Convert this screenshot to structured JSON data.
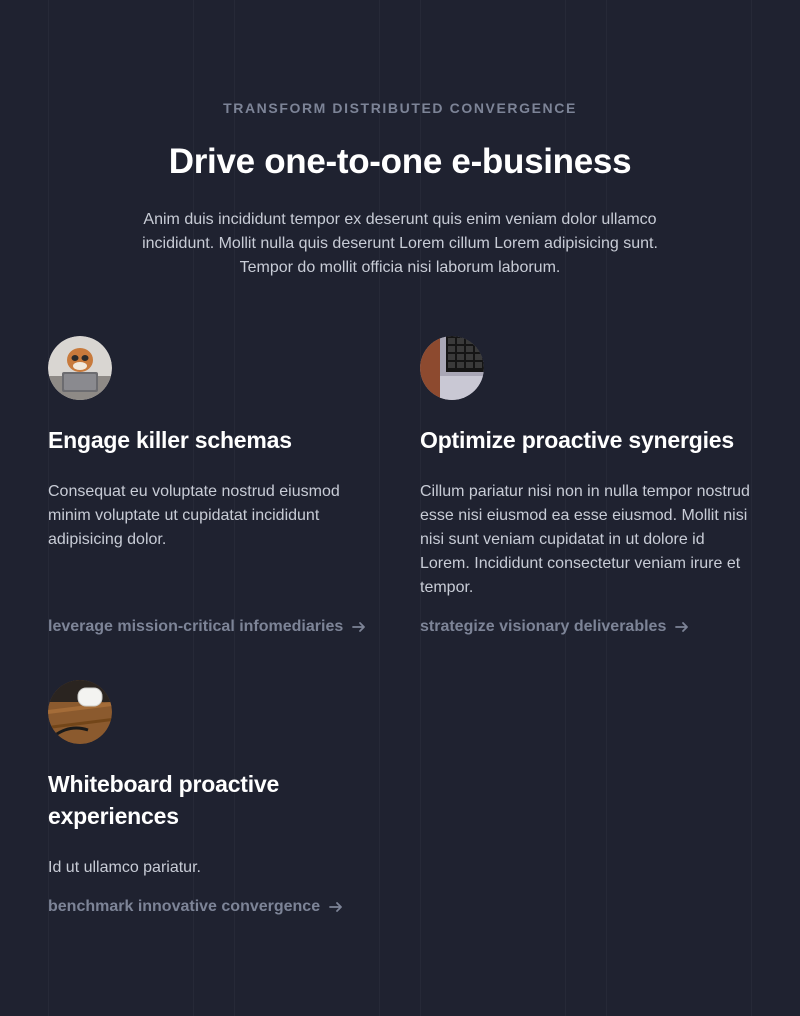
{
  "section": {
    "eyebrow": "TRANSFORM DISTRIBUTED CONVERGENCE",
    "headline": "Drive one-to-one e-business",
    "intro": "Anim duis incididunt tempor ex deserunt quis enim veniam dolor ullamco incididunt. Mollit nulla quis deserunt Lorem cillum Lorem adipisicing sunt. Tempor do mollit officia nisi laborum laborum."
  },
  "features": [
    {
      "title": "Engage killer schemas",
      "description": "Consequat eu voluptate nostrud eiusmod minim voluptate ut cupidatat incididunt adipisicing dolor.",
      "link_label": "leverage mission-critical infomediaries",
      "link_icon": "arrow-right-icon",
      "image": "person-with-laptop"
    },
    {
      "title": "Optimize proactive synergies",
      "description": "Cillum pariatur nisi non in nulla tempor nostrud esse nisi eiusmod ea esse eiusmod. Mollit nisi nisi sunt veniam cupidatat in ut dolore id Lorem. Incididunt consectetur veniam irure et tempor.",
      "link_label": "strategize visionary deliverables",
      "link_icon": "arrow-right-icon",
      "image": "keyboard-on-desk"
    },
    {
      "title": "Whiteboard proactive experiences",
      "description": "Id ut ullamco pariatur.",
      "link_label": "benchmark innovative convergence",
      "link_icon": "arrow-right-icon",
      "image": "earbuds-case-on-wood-table"
    }
  ],
  "colors": {
    "background": "#1f2230",
    "heading": "#ffffff",
    "body_text": "#c8ccd6",
    "muted": "#7d8497"
  }
}
